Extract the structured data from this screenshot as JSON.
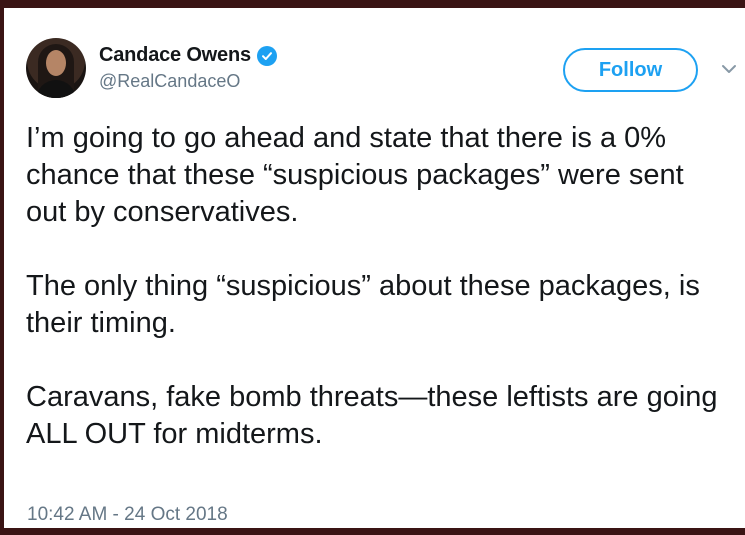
{
  "author": {
    "display_name": "Candace Owens",
    "handle": "@RealCandaceO",
    "verified": true
  },
  "actions": {
    "follow_label": "Follow"
  },
  "tweet": {
    "paragraphs": [
      "I’m going to go ahead and state that there is a 0% chance that these “suspicious packages” were sent out by conservatives.",
      "The only thing “suspicious” about these packages, is their timing.",
      "Caravans, fake bomb threats—these leftists are going ALL OUT for midterms."
    ],
    "timestamp": "10:42 AM - 24 Oct 2018"
  },
  "icons": {
    "verified": "verified-badge-icon",
    "caret": "chevron-down-icon"
  },
  "colors": {
    "accent": "#1da1f2",
    "secondary_text": "#657786",
    "primary_text": "#14171a",
    "border_frame": "#3a1414"
  }
}
